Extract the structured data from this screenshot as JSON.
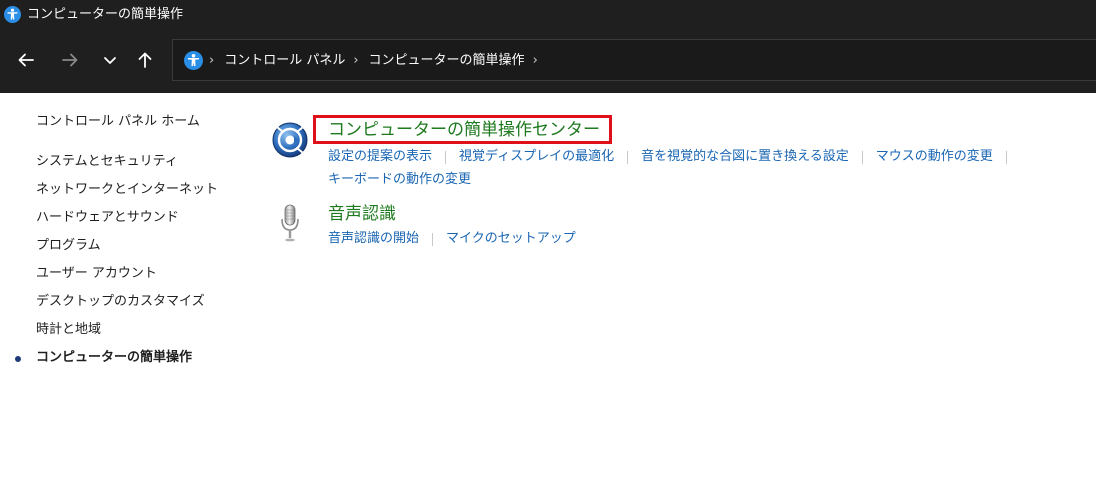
{
  "window": {
    "title": "コンピューターの簡単操作"
  },
  "nav": {
    "back_icon": "arrow-left-icon",
    "forward_icon": "arrow-right-icon",
    "recent_icon": "chevron-down-icon",
    "up_icon": "arrow-up-icon"
  },
  "address": {
    "crumbs": [
      "コントロール パネル",
      "コンピューターの簡単操作"
    ],
    "separator": "›"
  },
  "sidebar": {
    "home": "コントロール パネル ホーム",
    "items": [
      "システムとセキュリティ",
      "ネットワークとインターネット",
      "ハードウェアとサウンド",
      "プログラム",
      "ユーザー アカウント",
      "デスクトップのカスタマイズ",
      "時計と地域",
      "コンピューターの簡単操作"
    ],
    "current_index": 7
  },
  "main": {
    "categories": [
      {
        "title": "コンピューターの簡単操作センター",
        "icon": "ease-of-access-center-icon",
        "highlighted": true,
        "links_row1": [
          "設定の提案の表示",
          "視覚ディスプレイの最適化",
          "音を視覚的な合図に置き換える設定",
          "マウスの動作の変更"
        ],
        "links_row2": [
          "キーボードの動作の変更"
        ]
      },
      {
        "title": "音声認識",
        "icon": "microphone-icon",
        "links_row1": [
          "音声認識の開始",
          "マイクのセットアップ"
        ]
      }
    ]
  },
  "colors": {
    "titlebar_bg": "#1f1f1f",
    "link": "#1a66b3",
    "category_title": "#1e7a1e",
    "highlight_border": "#e0101a",
    "accessibility_blue": "#2a8ee6"
  }
}
